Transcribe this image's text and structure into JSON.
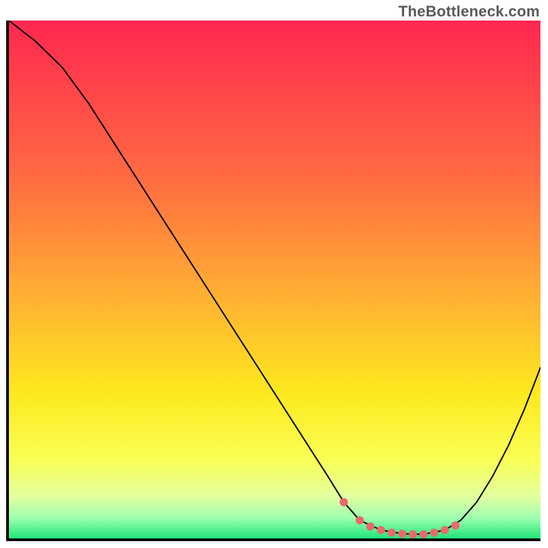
{
  "watermark": "TheBottleneck.com",
  "chart_data": {
    "type": "line",
    "title": "",
    "xlabel": "",
    "ylabel": "",
    "xlim": [
      0,
      100
    ],
    "ylim": [
      0,
      100
    ],
    "grid": false,
    "legend": false,
    "background_gradient": {
      "type": "vertical",
      "stops": [
        {
          "pos": 0.0,
          "color": "#ff2750"
        },
        {
          "pos": 0.3,
          "color": "#ff6a42"
        },
        {
          "pos": 0.55,
          "color": "#ffb531"
        },
        {
          "pos": 0.72,
          "color": "#fde91e"
        },
        {
          "pos": 0.85,
          "color": "#f9ff55"
        },
        {
          "pos": 0.92,
          "color": "#e2ffa0"
        },
        {
          "pos": 0.96,
          "color": "#9fffb0"
        },
        {
          "pos": 1.0,
          "color": "#20e67a"
        }
      ]
    },
    "series": [
      {
        "name": "bottleneck-curve",
        "color": "#000000",
        "stroke_width": 2,
        "x": [
          0,
          5,
          10,
          15,
          20,
          25,
          30,
          35,
          40,
          45,
          50,
          55,
          60,
          63,
          66,
          70,
          74,
          78,
          82,
          85,
          88,
          91,
          94,
          97,
          100
        ],
        "values": [
          100,
          96,
          91,
          84,
          76,
          68,
          60,
          52,
          44,
          36,
          28,
          20,
          12,
          7,
          3.5,
          1.6,
          0.9,
          0.8,
          1.6,
          3.5,
          7,
          12,
          18,
          25,
          33
        ]
      }
    ],
    "markers": {
      "name": "optimal-range",
      "color": "#e76b6b",
      "radius": 6,
      "x": [
        63,
        66,
        68,
        70,
        72,
        74,
        76,
        78,
        80,
        82,
        84
      ],
      "values": [
        7,
        3.5,
        2.3,
        1.6,
        1.1,
        0.9,
        0.8,
        0.8,
        1.1,
        1.6,
        2.5
      ]
    }
  }
}
